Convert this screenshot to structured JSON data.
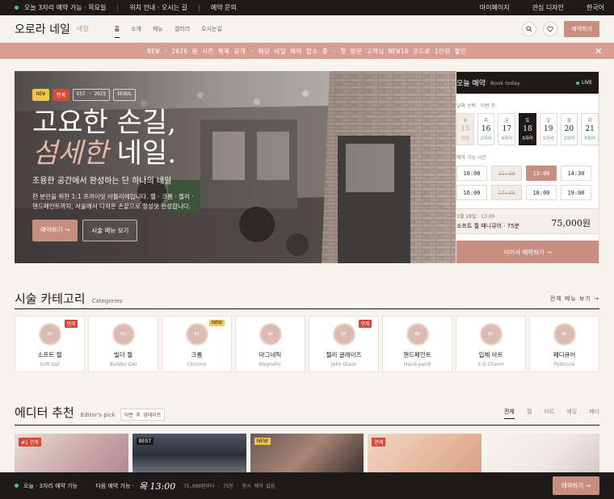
{
  "topbar": {
    "left": "오늘 3자리 예약 가능 · 목요일",
    "links": [
      "위치 안내 · 오시는 길",
      "예약 문의"
    ],
    "right": [
      "마이페이지",
      "관심 디자인",
      "한국어"
    ]
  },
  "header": {
    "logo": "오로라 네일",
    "logo_sub": "네일",
    "nav": [
      "홈",
      "소개",
      "메뉴",
      "갤러리",
      "오시는길"
    ],
    "book_label": "예약하기",
    "search_icon": "search-icon",
    "heart_icon": "heart-icon"
  },
  "promo": {
    "text": "NEW · 2026 봄 시즌 룩북 공개 · 웨딩 네일 예약 접수 중 · 첫 방문 고객님 NEW10 코드로 1만원 할인",
    "close_icon": "close-icon"
  },
  "hero": {
    "chips": [
      "NEW",
      "연계",
      "EST · 2023",
      "SEOUL"
    ],
    "title_line1": "고요한 손길,",
    "title_accent": "섬세한",
    "title_rest": " 네일.",
    "subtitle": "조용한 공간에서 완성하는 단 하나의 네일",
    "desc": "한 분만을 위한 1:1 프라이빗 아틀리에입니다. 젤 · 크롬 · 젤리 · 핸드페인트까지, 서울에서 다져온 손끝으로 정성껏 완성합니다.",
    "btn_book": "예약하기 →",
    "btn_menu": "시술 메뉴 보기"
  },
  "booking": {
    "title": "오늘 예약",
    "title_en": "Book today",
    "live": "LIVE",
    "date_label": "날짜 선택 · 이번 주",
    "days": [
      {
        "dow": "수",
        "num": "15",
        "slots": "마감",
        "state": "off"
      },
      {
        "dow": "목",
        "num": "16",
        "slots": "2자리",
        "state": ""
      },
      {
        "dow": "금",
        "num": "17",
        "slots": "4자리",
        "state": ""
      },
      {
        "dow": "토",
        "num": "18",
        "slots": "3자리",
        "state": "sel"
      },
      {
        "dow": "일",
        "num": "19",
        "slots": "1자리",
        "state": ""
      },
      {
        "dow": "월",
        "num": "20",
        "slots": "2자리",
        "state": ""
      },
      {
        "dow": "화",
        "num": "21",
        "slots": "5자리",
        "state": ""
      }
    ],
    "time_label": "예약 가능 시간",
    "times": [
      {
        "t": "10:00",
        "state": ""
      },
      {
        "t": "11:30",
        "state": "off"
      },
      {
        "t": "13:00",
        "state": "sel"
      },
      {
        "t": "14:30",
        "state": ""
      },
      {
        "t": "16:00",
        "state": ""
      },
      {
        "t": "17:30",
        "state": "off"
      },
      {
        "t": "18:00",
        "state": ""
      },
      {
        "t": "19:00",
        "state": ""
      }
    ],
    "summary_date": "3월 18일 · 13:00",
    "summary_service": "소프트 젤 매니큐어 · 75분",
    "summary_price": "75,000원",
    "cta": "이어서 예약하기 →"
  },
  "categories": {
    "title": "시술 카테고리",
    "title_en": "Categories",
    "see_all": "전체 메뉴 보기 →",
    "items": [
      {
        "num": "01",
        "ko": "소프트 젤",
        "en": "Soft Gel",
        "badge": "연계",
        "badge_type": "red"
      },
      {
        "num": "02",
        "ko": "빌더 젤",
        "en": "Builder Gel",
        "badge": "",
        "badge_type": ""
      },
      {
        "num": "03",
        "ko": "크롬",
        "en": "Chrome",
        "badge": "NEW",
        "badge_type": "new"
      },
      {
        "num": "04",
        "ko": "마그네틱",
        "en": "Magnetic",
        "badge": "",
        "badge_type": ""
      },
      {
        "num": "05",
        "ko": "젤리 글레이즈",
        "en": "Jelly Glaze",
        "badge": "연계",
        "badge_type": "red"
      },
      {
        "num": "06",
        "ko": "핸드페인트",
        "en": "Hand-paint",
        "badge": "",
        "badge_type": ""
      },
      {
        "num": "07",
        "ko": "입체 아트",
        "en": "3-D Charm",
        "badge": "",
        "badge_type": ""
      },
      {
        "num": "08",
        "ko": "페디큐어",
        "en": "Pedicure",
        "badge": "",
        "badge_type": ""
      }
    ]
  },
  "editor": {
    "title": "에디터 추천",
    "title_en": "Editor's pick",
    "tag": "이번 주 업데이트",
    "tabs": [
      "전체",
      "젤",
      "아트",
      "웨딩",
      "페디"
    ],
    "cards": [
      {
        "badge": "#1 연계",
        "badge_type": "red"
      },
      {
        "badge": "BEST",
        "badge_type": "dark"
      },
      {
        "badge": "NEW",
        "badge_type": "yellow"
      },
      {
        "badge": "연계",
        "badge_type": "red"
      },
      {
        "badge": "",
        "badge_type": ""
      }
    ]
  },
  "bottom": {
    "status": "오늘 · 3자리 예약 가능",
    "next_label": "다음 예약 가능 ·",
    "next_time": "목 13:00",
    "meta": "75,000원부터 · 75분 · 동시 예약 없음",
    "cta": "예약하기 →"
  },
  "colors": {
    "accent": "#c88e80",
    "dark": "#1d1a19",
    "promo": "#d79f92",
    "live": "#3fd07a",
    "badge_red": "#d54b3a",
    "badge_yellow": "#f0c34d"
  }
}
